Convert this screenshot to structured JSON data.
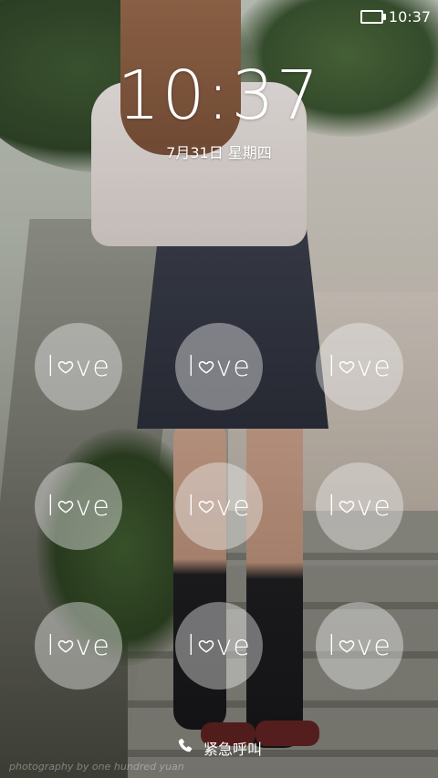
{
  "status_bar": {
    "time": "10:37",
    "battery_icon": "battery-icon"
  },
  "lock_screen": {
    "time": "10:37",
    "date": "7月31日 星期四"
  },
  "pattern_dots": [
    {
      "label": "love"
    },
    {
      "label": "love"
    },
    {
      "label": "love"
    },
    {
      "label": "love"
    },
    {
      "label": "love"
    },
    {
      "label": "love"
    },
    {
      "label": "love"
    },
    {
      "label": "love"
    },
    {
      "label": "love"
    }
  ],
  "footer": {
    "emergency_call": "紧急呼叫",
    "emergency_icon": "phone-icon",
    "photo_credit": "photography by one hundred yuan"
  },
  "colors": {
    "text": "#ffffff",
    "dot_fill": "rgba(240,240,240,0.42)"
  }
}
